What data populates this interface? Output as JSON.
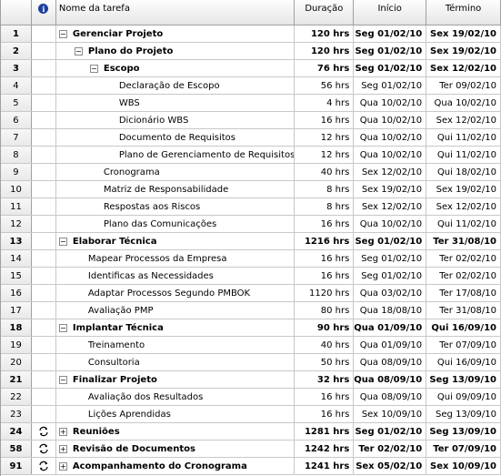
{
  "columns": {
    "name": "Nome da tarefa",
    "duration": "Duração",
    "start": "Início",
    "end": "Término"
  },
  "rows": [
    {
      "id": "1",
      "name": "Gerenciar Projeto",
      "duration": "120 hrs",
      "start": "Seg 01/02/10",
      "end": "Sex 19/02/10",
      "level": 0,
      "summary": true,
      "toggle": "−",
      "recurring": false
    },
    {
      "id": "2",
      "name": "Plano do Projeto",
      "duration": "120 hrs",
      "start": "Seg 01/02/10",
      "end": "Sex 19/02/10",
      "level": 1,
      "summary": true,
      "toggle": "−",
      "recurring": false
    },
    {
      "id": "3",
      "name": "Escopo",
      "duration": "76 hrs",
      "start": "Seg 01/02/10",
      "end": "Sex 12/02/10",
      "level": 2,
      "summary": true,
      "toggle": "−",
      "recurring": false
    },
    {
      "id": "4",
      "name": "Declaração de Escopo",
      "duration": "56 hrs",
      "start": "Seg 01/02/10",
      "end": "Ter 09/02/10",
      "level": 3,
      "summary": false,
      "toggle": "",
      "recurring": false
    },
    {
      "id": "5",
      "name": "WBS",
      "duration": "4 hrs",
      "start": "Qua 10/02/10",
      "end": "Qua 10/02/10",
      "level": 3,
      "summary": false,
      "toggle": "",
      "recurring": false
    },
    {
      "id": "6",
      "name": "Dicionário WBS",
      "duration": "16 hrs",
      "start": "Qua 10/02/10",
      "end": "Sex 12/02/10",
      "level": 3,
      "summary": false,
      "toggle": "",
      "recurring": false
    },
    {
      "id": "7",
      "name": "Documento de Requisitos",
      "duration": "12 hrs",
      "start": "Qua 10/02/10",
      "end": "Qui 11/02/10",
      "level": 3,
      "summary": false,
      "toggle": "",
      "recurring": false
    },
    {
      "id": "8",
      "name": "Plano de Gerenciamento de Requisitos",
      "duration": "12 hrs",
      "start": "Qua 10/02/10",
      "end": "Qui 11/02/10",
      "level": 3,
      "summary": false,
      "toggle": "",
      "recurring": false
    },
    {
      "id": "9",
      "name": "Cronograma",
      "duration": "40 hrs",
      "start": "Sex 12/02/10",
      "end": "Qui 18/02/10",
      "level": 2,
      "summary": false,
      "toggle": "",
      "recurring": false
    },
    {
      "id": "10",
      "name": "Matriz de Responsabilidade",
      "duration": "8 hrs",
      "start": "Sex 19/02/10",
      "end": "Sex 19/02/10",
      "level": 2,
      "summary": false,
      "toggle": "",
      "recurring": false
    },
    {
      "id": "11",
      "name": "Respostas aos Riscos",
      "duration": "8 hrs",
      "start": "Sex 12/02/10",
      "end": "Sex 12/02/10",
      "level": 2,
      "summary": false,
      "toggle": "",
      "recurring": false
    },
    {
      "id": "12",
      "name": "Plano das Comunicações",
      "duration": "16 hrs",
      "start": "Qua 10/02/10",
      "end": "Qui 11/02/10",
      "level": 2,
      "summary": false,
      "toggle": "",
      "recurring": false
    },
    {
      "id": "13",
      "name": "Elaborar Técnica",
      "duration": "1216 hrs",
      "start": "Seg 01/02/10",
      "end": "Ter 31/08/10",
      "level": 0,
      "summary": true,
      "toggle": "−",
      "recurring": false
    },
    {
      "id": "14",
      "name": "Mapear Processos da Empresa",
      "duration": "16 hrs",
      "start": "Seg 01/02/10",
      "end": "Ter 02/02/10",
      "level": 1,
      "summary": false,
      "toggle": "",
      "recurring": false
    },
    {
      "id": "15",
      "name": "Identificas as Necessidades",
      "duration": "16 hrs",
      "start": "Seg 01/02/10",
      "end": "Ter 02/02/10",
      "level": 1,
      "summary": false,
      "toggle": "",
      "recurring": false
    },
    {
      "id": "16",
      "name": "Adaptar Processos Segundo PMBOK",
      "duration": "1120 hrs",
      "start": "Qua 03/02/10",
      "end": "Ter 17/08/10",
      "level": 1,
      "summary": false,
      "toggle": "",
      "recurring": false
    },
    {
      "id": "17",
      "name": "Avaliação PMP",
      "duration": "80 hrs",
      "start": "Qua 18/08/10",
      "end": "Ter 31/08/10",
      "level": 1,
      "summary": false,
      "toggle": "",
      "recurring": false
    },
    {
      "id": "18",
      "name": "Implantar Técnica",
      "duration": "90 hrs",
      "start": "Qua 01/09/10",
      "end": "Qui 16/09/10",
      "level": 0,
      "summary": true,
      "toggle": "−",
      "recurring": false
    },
    {
      "id": "19",
      "name": "Treinamento",
      "duration": "40 hrs",
      "start": "Qua 01/09/10",
      "end": "Ter 07/09/10",
      "level": 1,
      "summary": false,
      "toggle": "",
      "recurring": false
    },
    {
      "id": "20",
      "name": "Consultoria",
      "duration": "50 hrs",
      "start": "Qua 08/09/10",
      "end": "Qui 16/09/10",
      "level": 1,
      "summary": false,
      "toggle": "",
      "recurring": false
    },
    {
      "id": "21",
      "name": "Finalizar Projeto",
      "duration": "32 hrs",
      "start": "Qua 08/09/10",
      "end": "Seg 13/09/10",
      "level": 0,
      "summary": true,
      "toggle": "−",
      "recurring": false
    },
    {
      "id": "22",
      "name": "Avaliação dos Resultados",
      "duration": "16 hrs",
      "start": "Qua 08/09/10",
      "end": "Qui 09/09/10",
      "level": 1,
      "summary": false,
      "toggle": "",
      "recurring": false
    },
    {
      "id": "23",
      "name": "Lições Aprendidas",
      "duration": "16 hrs",
      "start": "Sex 10/09/10",
      "end": "Seg 13/09/10",
      "level": 1,
      "summary": false,
      "toggle": "",
      "recurring": false
    },
    {
      "id": "24",
      "name": "Reuniões",
      "duration": "1281 hrs",
      "start": "Seg 01/02/10",
      "end": "Seg 13/09/10",
      "level": 0,
      "summary": true,
      "toggle": "+",
      "recurring": true
    },
    {
      "id": "58",
      "name": "Revisão de Documentos",
      "duration": "1242 hrs",
      "start": "Ter 02/02/10",
      "end": "Ter 07/09/10",
      "level": 0,
      "summary": true,
      "toggle": "+",
      "recurring": true
    },
    {
      "id": "91",
      "name": "Acompanhamento do Cronograma",
      "duration": "1241 hrs",
      "start": "Sex 05/02/10",
      "end": "Sex 10/09/10",
      "level": 0,
      "summary": true,
      "toggle": "+",
      "recurring": true
    }
  ],
  "icons": {
    "header_indicator": "info-icon",
    "recurring": "recurring-task-icon"
  }
}
